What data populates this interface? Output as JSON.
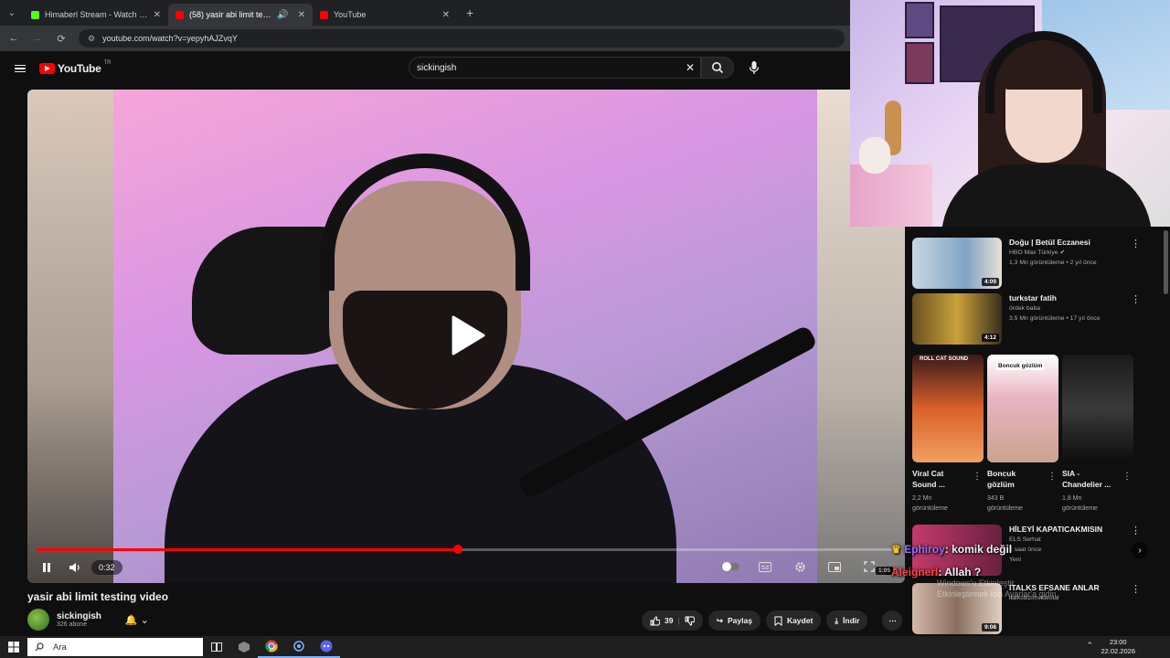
{
  "browser": {
    "tabs": [
      {
        "label": "Himaberl Stream - Watch Live o",
        "color": "#53fc18",
        "active": false
      },
      {
        "label": "(58) yasir abi limit testing vi",
        "color": "#ff0000",
        "active": true
      },
      {
        "label": "YouTube",
        "color": "#ff0000",
        "active": false
      }
    ],
    "url": "youtube.com/watch?v=yepyhAJZvqY"
  },
  "youtube": {
    "logo_text": "YouTube",
    "country": "TR",
    "search_value": "sickingish"
  },
  "player": {
    "current_time": "0:32",
    "duration": "1:05",
    "progress": 0.49
  },
  "video": {
    "title": "yasir abi limit testing video",
    "channel": "sickingish",
    "subscribers": "326 abone",
    "likes": "39",
    "share_label": "Paylaş",
    "save_label": "Kaydet",
    "download_label": "İndir"
  },
  "sidebar": {
    "videos": [
      {
        "title": "Doğu | Betül Eczanesi",
        "channel": "HBO Max Türkiye",
        "stats": "1,3 Mn görüntüleme • 2 yıl önce",
        "duration": "4:09",
        "thumb": "#b8c9d8"
      },
      {
        "title": "turkstar fatih",
        "channel": "ördek baba",
        "stats": "3,5 Mn görüntüleme • 17 yıl önce",
        "duration": "4:12",
        "thumb": "#8a6a2a"
      }
    ],
    "shorts": [
      {
        "title_l1": "Viral Cat",
        "title_l2": "Sound ...",
        "views_l1": "2,2 Mn",
        "views_l2": "görüntüleme",
        "caption": "ROLL CAT SOUND"
      },
      {
        "title_l1": "Boncuk",
        "title_l2": "gözlüm",
        "views_l1": "343 B",
        "views_l2": "görüntüleme",
        "caption": "Boncuk gözlüm"
      },
      {
        "title_l1": "SIA -",
        "title_l2": "Chandelier ...",
        "views_l1": "1,8 Mn",
        "views_l2": "görüntüleme",
        "caption": ""
      }
    ],
    "lower": [
      {
        "title": "HİLEYİ KAPATICAKMISIN",
        "channel": "ELS Serhat",
        "stats": "8 saat önce",
        "badge": "Yeni"
      },
      {
        "title": "ITALKS EFSANE ANLAR",
        "channel": "italksbizimvideolar",
        "stats": "",
        "duration": "9:08"
      }
    ]
  },
  "chat": [
    {
      "user": "Ephiroy",
      "message": ": komik değil"
    },
    {
      "user": "Aleignerl",
      "message": ": Allah ?"
    }
  ],
  "watermark": {
    "line1": "Windows'u Etkinleştir",
    "line2": "Etkinleştirmek için Ayarlar'a gidin."
  },
  "taskbar": {
    "search_placeholder": "Ara",
    "time": "23:00",
    "date": "22.02.2026"
  }
}
